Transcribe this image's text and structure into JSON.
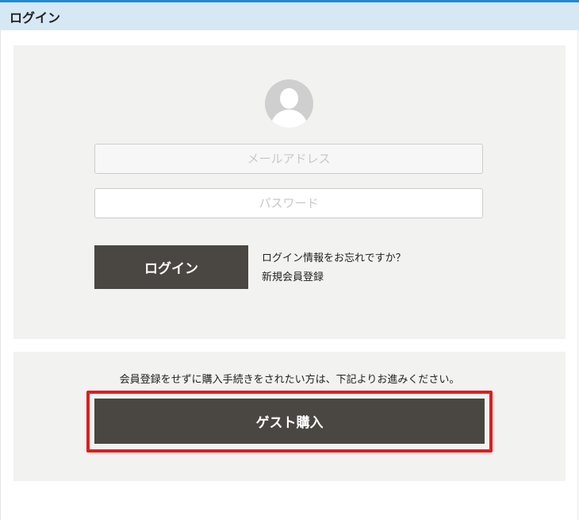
{
  "header": {
    "title": "ログイン"
  },
  "login": {
    "avatar_icon": "user-avatar-icon",
    "email_placeholder": "メールアドレス",
    "password_placeholder": "パスワード",
    "login_button_label": "ログイン",
    "forgot_link": "ログイン情報をお忘れですか？",
    "register_link": "新規会員登録"
  },
  "guest": {
    "description": "会員登録をせずに購入手続きをされたい方は、下記よりお進みください。",
    "guest_button_label": "ゲスト購入",
    "highlight_color": "#e31b1b"
  },
  "colors": {
    "header_bg": "#d5e8f4",
    "header_accent": "#1f8ad6",
    "panel_bg": "#f2f2f1",
    "button_bg": "#4a4641"
  }
}
